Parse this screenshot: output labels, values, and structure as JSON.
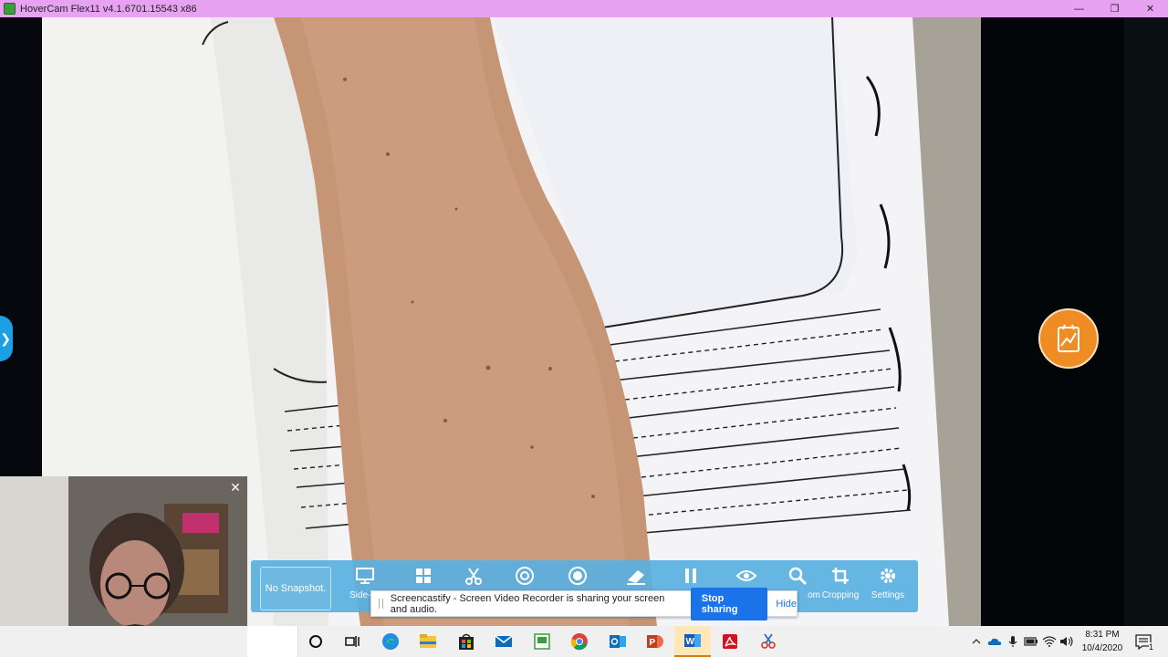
{
  "window": {
    "title": "HoverCam Flex11 v4.1.6701.15543 x86",
    "minimize_glyph": "—",
    "restore_glyph": "❐",
    "close_glyph": "✕"
  },
  "side_tab": {
    "glyph": "❯"
  },
  "toolbar": {
    "snapshot_label": "No Snapshot.",
    "tools": [
      {
        "icon": "monitor-icon",
        "label": "Side-by"
      },
      {
        "icon": "windows-icon",
        "label": ""
      },
      {
        "icon": "cut-icon",
        "label": ""
      },
      {
        "icon": "camera-shutter-icon",
        "label": ""
      },
      {
        "icon": "record-icon",
        "label": ""
      },
      {
        "icon": "eraser-icon",
        "label": ""
      },
      {
        "icon": "pause-icon",
        "label": ""
      },
      {
        "icon": "eye-icon",
        "label": ""
      },
      {
        "icon": "zoom-icon",
        "label": "om"
      },
      {
        "icon": "crop-icon",
        "label": "Cropping"
      },
      {
        "icon": "gear-icon",
        "label": "Settings"
      }
    ]
  },
  "share_bar": {
    "message": "Screencastify - Screen Video Recorder is sharing your screen and audio.",
    "stop_label": "Stop sharing",
    "hide_label": "Hide"
  },
  "webcam": {
    "close_glyph": "✕",
    "popout_glyph": "⧉"
  },
  "taskbar": {
    "apps": [
      "cortana-icon",
      "task-view-icon",
      "edge-icon",
      "file-explorer-icon",
      "store-icon",
      "mail-icon",
      "flex11-icon",
      "chrome-icon",
      "outlook-icon",
      "powerpoint-icon",
      "word-icon",
      "acrobat-icon",
      "snip-icon"
    ],
    "active_app": "word-icon",
    "tray": [
      "chevron-up-icon",
      "onedrive-icon",
      "microphone-icon",
      "battery-icon",
      "wifi-icon",
      "volume-icon"
    ],
    "time": "8:31 PM",
    "date": "10/4/2020",
    "notification_count": "1"
  },
  "colors": {
    "titlebar": "#e7a3f2",
    "toolbar": "#59b0e1",
    "fab": "#ef8d24",
    "stop_button": "#1a73e8"
  }
}
